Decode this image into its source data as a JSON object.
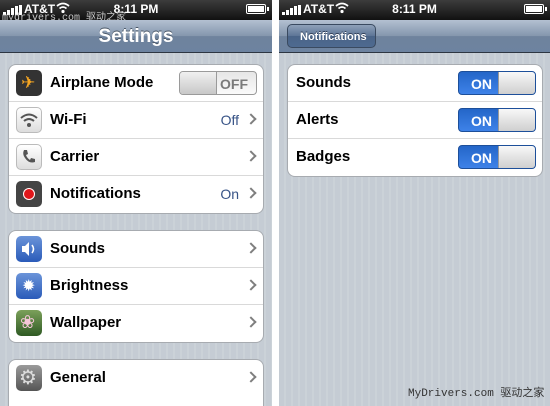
{
  "left": {
    "status": {
      "carrier": "AT&T",
      "time": "8:11 PM",
      "overlay_text": "mydrivers.com 驱动之家"
    },
    "nav_title": "Settings",
    "groups": [
      {
        "rows": [
          {
            "label": "Airplane Mode",
            "icon": "airplane-icon",
            "toggle": "OFF"
          },
          {
            "label": "Wi-Fi",
            "icon": "wifi-icon",
            "detail": "Off"
          },
          {
            "label": "Carrier",
            "icon": "phone-icon"
          },
          {
            "label": "Notifications",
            "icon": "notifications-icon",
            "detail": "On"
          }
        ]
      },
      {
        "rows": [
          {
            "label": "Sounds",
            "icon": "speaker-icon"
          },
          {
            "label": "Brightness",
            "icon": "brightness-icon"
          },
          {
            "label": "Wallpaper",
            "icon": "wallpaper-icon"
          }
        ]
      },
      {
        "rows": [
          {
            "label": "General",
            "icon": "gear-icon"
          }
        ]
      }
    ]
  },
  "right": {
    "status": {
      "carrier": "AT&T",
      "time": "8:11 PM"
    },
    "back_label": "Notifications",
    "rows": [
      {
        "label": "Sounds",
        "toggle": "ON"
      },
      {
        "label": "Alerts",
        "toggle": "ON"
      },
      {
        "label": "Badges",
        "toggle": "ON"
      }
    ]
  },
  "footer_watermark": "MyDrivers.com 驱动之家",
  "colors": {
    "nav_bar": "#6f839d",
    "toggle_on": "#2e74dc",
    "detail_text": "#385487"
  }
}
